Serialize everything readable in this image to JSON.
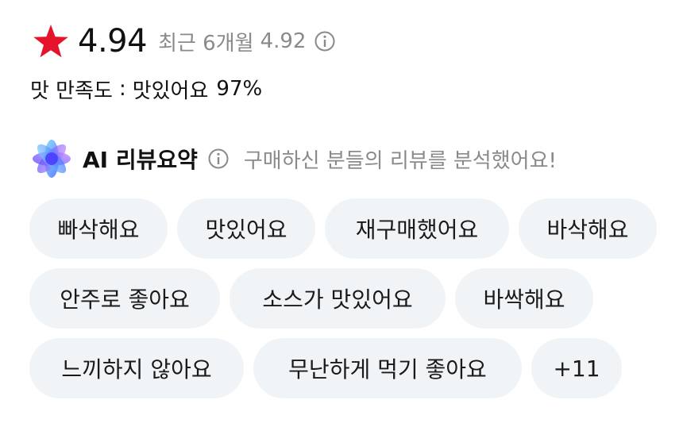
{
  "rating": {
    "star_icon": "star-icon",
    "star_color": "#e5142c",
    "value": "4.94",
    "recent_label": "최근 6개월",
    "recent_value": "4.92",
    "info_icon": "info-icon"
  },
  "satisfaction": {
    "label": "맛 만족도",
    "separator": ":",
    "value_text": "맛있어요",
    "percent": "97%"
  },
  "ai_summary": {
    "logo_icon": "ai-sparkle-icon",
    "title": "AI 리뷰요약",
    "info_icon": "info-icon",
    "description": "구매하신 분들의 리뷰를 분석했어요!"
  },
  "tags": [
    "빠삭해요",
    "맛있어요",
    "재구매했어요",
    "바삭해요",
    "안주로 좋아요",
    "소스가 맛있어요",
    "바싹해요",
    "느끼하지 않아요",
    "무난하게 먹기 좋아요"
  ],
  "more_button": "+11",
  "colors": {
    "chip_bg": "#f1f4f7",
    "muted_text": "#8a8a8a",
    "primary_text": "#111111"
  }
}
